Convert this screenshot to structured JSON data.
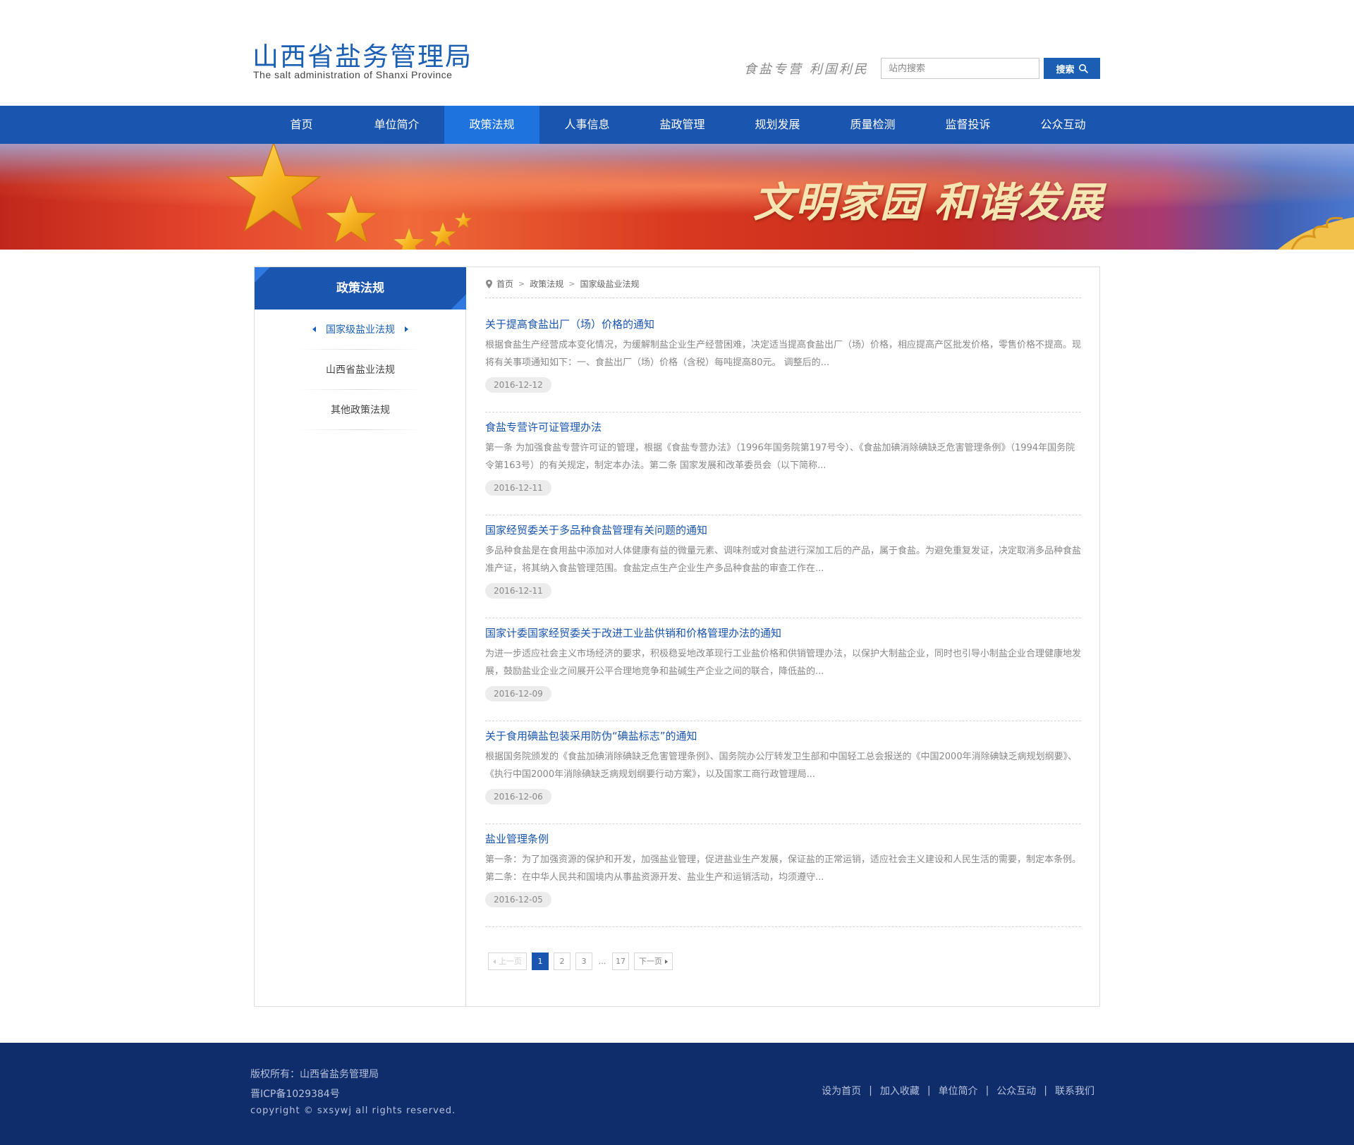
{
  "header": {
    "title_cn": "山西省盐务管理局",
    "title_en": "The salt administration of Shanxi Province",
    "slogan": "食盐专营 利国利民",
    "search_placeholder": "站内搜索",
    "search_button": "搜索"
  },
  "nav": {
    "items": [
      {
        "label": "首页"
      },
      {
        "label": "单位简介"
      },
      {
        "label": "政策法规",
        "active": true
      },
      {
        "label": "人事信息"
      },
      {
        "label": "盐政管理"
      },
      {
        "label": "规划发展"
      },
      {
        "label": "质量检测"
      },
      {
        "label": "监督投诉"
      },
      {
        "label": "公众互动"
      }
    ]
  },
  "banner": {
    "text_left": "文明家园",
    "text_right": "和谐发展"
  },
  "sidebar": {
    "title": "政策法规",
    "items": [
      {
        "label": "国家级盐业法规",
        "active": true
      },
      {
        "label": "山西省盐业法规"
      },
      {
        "label": "其他政策法规"
      }
    ]
  },
  "breadcrumb": {
    "items": [
      "首页",
      "政策法规",
      "国家级盐业法规"
    ]
  },
  "articles": [
    {
      "title": "关于提高食盐出厂（场）价格的通知",
      "summary": "根据食盐生产经营成本变化情况，为缓解制盐企业生产经营困难，决定适当提高食盐出厂（场）价格，相应提高产区批发价格，零售价格不提高。现将有关事项通知如下：一、食盐出厂（场）价格（含税）每吨提高80元。 调整后的...",
      "date": "2016-12-12"
    },
    {
      "title": "食盐专营许可证管理办法",
      "summary": "第一条 为加强食盐专营许可证的管理，根据《食盐专营办法》（1996年国务院第197号令）、《食盐加碘消除碘缺乏危害管理条例》（1994年国务院令第163号）的有关规定，制定本办法。第二条 国家发展和改革委员会（以下简称...",
      "date": "2016-12-11"
    },
    {
      "title": "国家经贸委关于多品种食盐管理有关问题的通知",
      "summary": "多品种食盐是在食用盐中添加对人体健康有益的微量元素、调味剂或对食盐进行深加工后的产品，属于食盐。为避免重复发证，决定取消多品种食盐准产证，将其纳入食盐管理范围。食盐定点生产企业生产多品种食盐的审查工作在...",
      "date": "2016-12-11"
    },
    {
      "title": "国家计委国家经贸委关于改进工业盐供销和价格管理办法的通知",
      "summary": "为进一步适应社会主义市场经济的要求，积极稳妥地改革现行工业盐价格和供销管理办法，以保护大制盐企业，同时也引导小制盐企业合理健康地发展，鼓励盐业企业之间展开公平合理地竞争和盐碱生产企业之间的联合，降低盐的...",
      "date": "2016-12-09"
    },
    {
      "title": "关于食用碘盐包装采用防伪“碘盐标志”的通知",
      "summary": "根据国务院颁发的《食盐加碘消除碘缺乏危害管理条例》、国务院办公厅转发卫生部和中国轻工总会报送的《中国2000年消除碘缺乏病规划纲要》、《执行中国2000年消除碘缺乏病规划纲要行动方案》，以及国家工商行政管理局...",
      "date": "2016-12-06"
    },
    {
      "title": "盐业管理条例",
      "summary": "第一条：为了加强资源的保护和开发，加强盐业管理，促进盐业生产发展，保证盐的正常运销，适应社会主义建设和人民生活的需要，制定本条例。第二条：在中华人民共和国境内从事盐资源开发、盐业生产和运销活动，均须遵守...",
      "date": "2016-12-05"
    }
  ],
  "pagination": {
    "prev": "上一页",
    "pages": [
      "1",
      "2",
      "3"
    ],
    "ellipsis": "...",
    "last": "17",
    "next": "下一页",
    "current": "1"
  },
  "footer": {
    "copyright_owner": "版权所有：山西省盐务管理局",
    "icp": "晋ICP备1029384号",
    "copyright": "copyright © sxsywj all rights reserved.",
    "links": [
      "设为首页",
      "加入收藏",
      "单位简介",
      "公众互动",
      "联系我们"
    ]
  },
  "colors": {
    "brand_blue": "#1a55b0",
    "nav_active": "#1e73df",
    "footer_bg": "#0f2c6b",
    "link_blue": "#1a55b0"
  }
}
